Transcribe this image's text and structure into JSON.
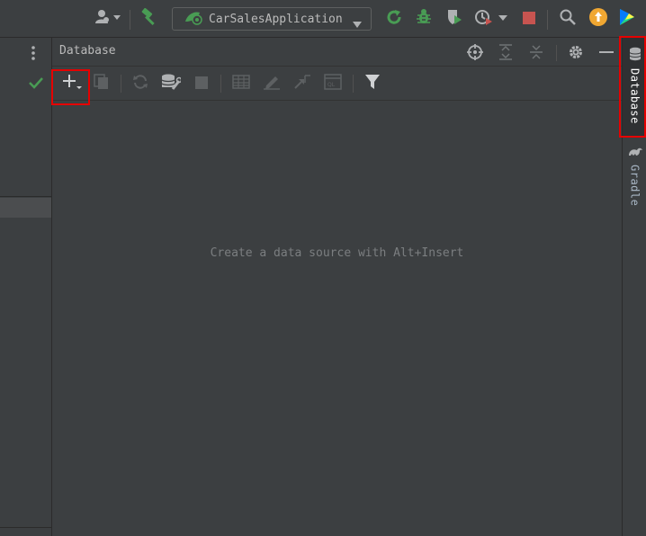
{
  "toolbar": {
    "run_config_label": "CarSalesApplication",
    "icons": [
      "user-vcs-icon",
      "build-hammer-icon",
      "run-icon",
      "debug-icon",
      "coverage-icon",
      "profiler-icon",
      "stop-icon",
      "search-icon",
      "update-icon",
      "toolbox-icon"
    ]
  },
  "database_panel": {
    "title": "Database",
    "empty_message": "Create a data source with Alt+Insert",
    "toolbar_icons": [
      "add-icon",
      "duplicate-icon",
      "refresh-icon",
      "properties-icon",
      "stop-icon",
      "table-icon",
      "edit-icon",
      "jump-icon",
      "console-icon",
      "filter-icon"
    ]
  },
  "right_stripe": {
    "tabs": [
      {
        "label": "Database",
        "icon": "database-icon",
        "active": true
      },
      {
        "label": "Gradle",
        "icon": "gradle-icon",
        "active": false
      }
    ]
  },
  "colors": {
    "background": "#3c3f41",
    "highlight_box": "#e60000",
    "run_green": "#499c54",
    "stop_red": "#c75450",
    "update_orange": "#f0a732"
  }
}
